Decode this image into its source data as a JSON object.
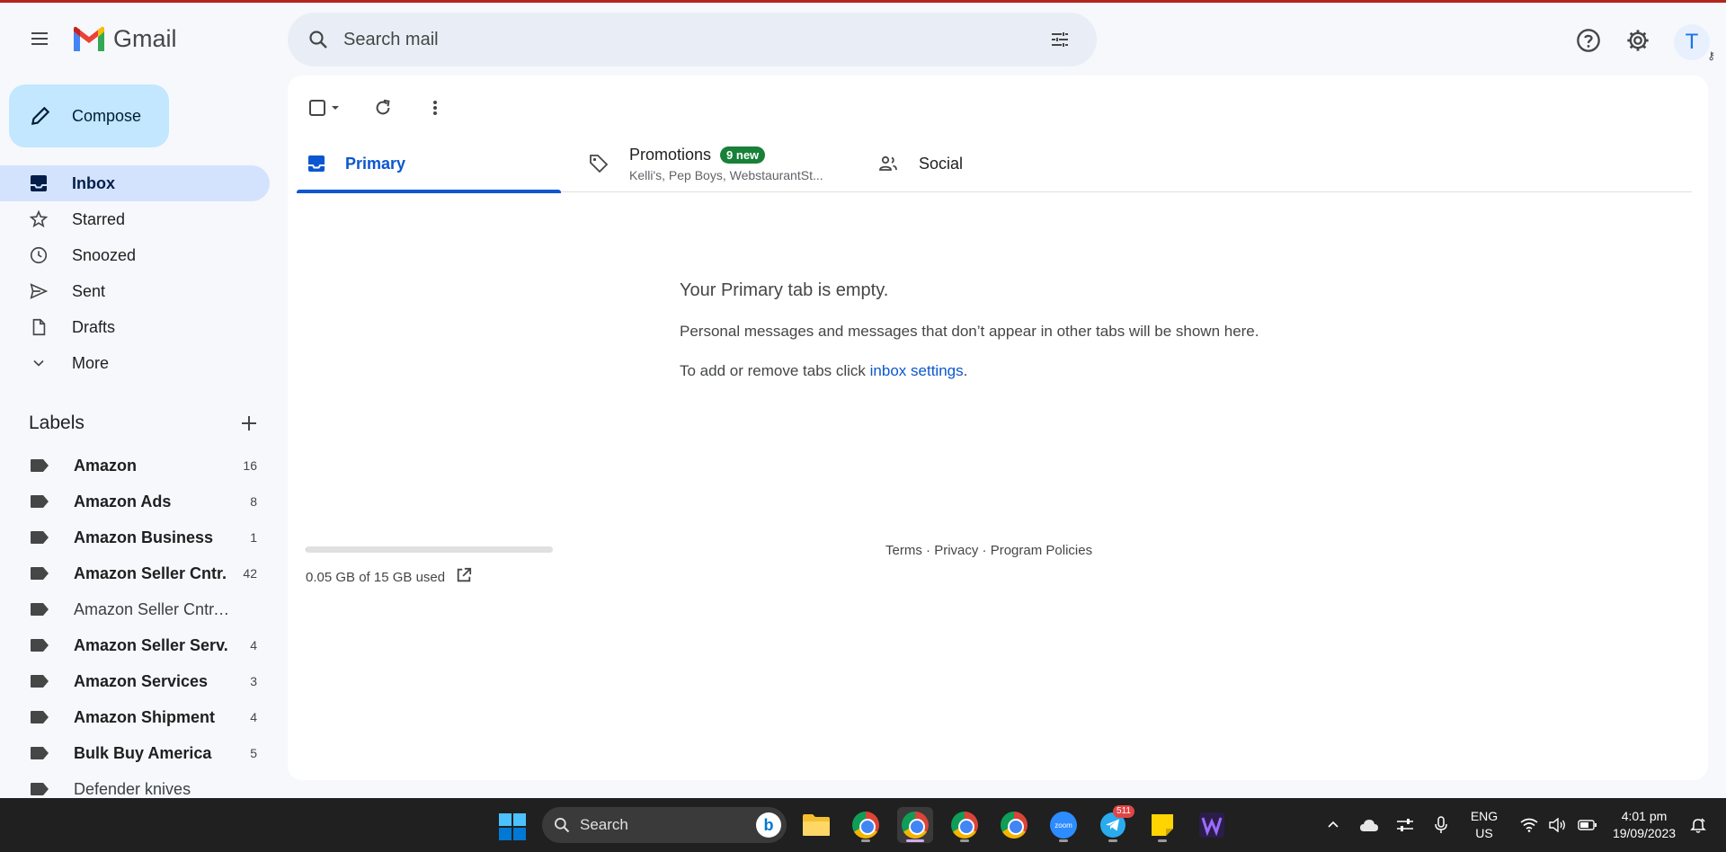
{
  "header": {
    "app_name": "Gmail",
    "search_placeholder": "Search mail",
    "avatar_letter": "T"
  },
  "sidebar": {
    "compose_label": "Compose",
    "nav_items": [
      {
        "label": "Inbox",
        "icon": "inbox-icon",
        "active": true
      },
      {
        "label": "Starred",
        "icon": "star-icon"
      },
      {
        "label": "Snoozed",
        "icon": "clock-icon"
      },
      {
        "label": "Sent",
        "icon": "send-icon"
      },
      {
        "label": "Drafts",
        "icon": "draft-icon"
      },
      {
        "label": "More",
        "icon": "chevron-down-icon"
      }
    ],
    "labels_title": "Labels",
    "labels": [
      {
        "name": "Amazon",
        "count": "16",
        "bold": true
      },
      {
        "name": "Amazon Ads",
        "count": "8",
        "bold": true
      },
      {
        "name": "Amazon Business",
        "count": "1",
        "bold": true
      },
      {
        "name": "Amazon Seller Cntr.",
        "count": "42",
        "bold": true
      },
      {
        "name": "Amazon Seller Cntr. Ref...",
        "count": "",
        "bold": false
      },
      {
        "name": "Amazon Seller Serv.",
        "count": "4",
        "bold": true
      },
      {
        "name": "Amazon Services",
        "count": "3",
        "bold": true
      },
      {
        "name": "Amazon Shipment",
        "count": "4",
        "bold": true
      },
      {
        "name": "Bulk Buy America",
        "count": "5",
        "bold": true
      },
      {
        "name": "Defender knives",
        "count": "",
        "bold": false
      }
    ]
  },
  "main": {
    "tabs": {
      "primary": "Primary",
      "promotions": "Promotions",
      "promotions_badge": "9 new",
      "promotions_senders": "Kelli's, Pep Boys, WebstaurantSt...",
      "social": "Social"
    },
    "empty_title": "Your Primary tab is empty.",
    "empty_desc": "Personal messages and messages that don’t appear in other tabs will be shown here.",
    "empty_add_prefix": "To add or remove tabs click ",
    "empty_add_link": "inbox settings",
    "empty_add_suffix": ".",
    "storage_text": "0.05 GB of 15 GB used",
    "storage_used_fraction": 0.0033,
    "footer": {
      "terms": "Terms",
      "privacy": "Privacy",
      "policies": "Program Policies",
      "sep": "·"
    }
  },
  "taskbar": {
    "search_label": "Search",
    "lang_line1": "ENG",
    "lang_line2": "US",
    "time": "4:01 pm",
    "date": "19/09/2023",
    "telegram_badge": "511"
  },
  "colors": {
    "accent": "#0b57d0",
    "compose_bg": "#c2e7ff",
    "active_nav": "#d3e3fd",
    "promo_badge": "#188038",
    "top_strip": "#b3261e"
  }
}
